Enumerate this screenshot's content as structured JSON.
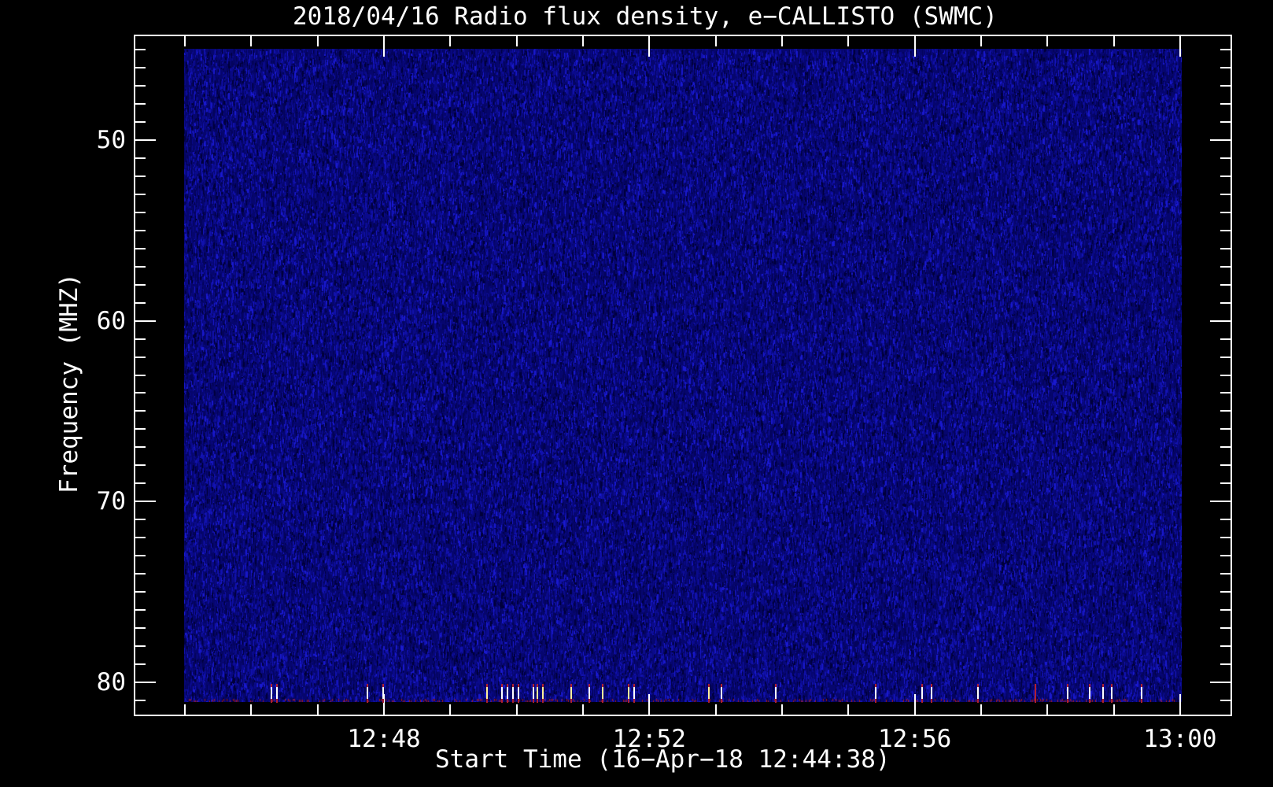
{
  "window": {
    "background": "#000000",
    "foreground": "#ffffff"
  },
  "chart_data": {
    "type": "heatmap",
    "title": "2018/04/16  Radio flux density, e−CALLISTO (SWMC)",
    "xlabel": "Start Time (16−Apr−18 12:44:38)",
    "ylabel": "Frequency (MHZ)",
    "legend": "none",
    "grid": false,
    "x_axis": {
      "start": "12:44:14",
      "end": "13:00:48",
      "major_ticks": [
        "12:48",
        "12:52",
        "12:56",
        "13:00"
      ],
      "minor_tick_interval_seconds": 60,
      "ticks_direction": "inward"
    },
    "y_axis": {
      "min_mhz": 44.2,
      "max_mhz": 81.9,
      "major_ticks": [
        50,
        60,
        70,
        80
      ],
      "minor_tick_interval_mhz": 1,
      "direction": "increasing-downward",
      "ticks_direction": "inward"
    },
    "image_extent": {
      "time_start": "12:45:00",
      "time_end": "13:00:01",
      "freq_start_mhz": 45.0,
      "freq_end_mhz": 81.1
    },
    "background_signal": {
      "description": "uniform dark-blue noise, no solar radio burst visible",
      "base_color": "#06066e",
      "palette": [
        "#00003a",
        "#04045c",
        "#0a0a8c",
        "#1111ad",
        "#1919cf"
      ],
      "bottom_edge_dot_color": "#a01818"
    },
    "rfi_marks": {
      "freq_mhz": 80.5,
      "colors": {
        "white": "#ffffff",
        "yellow": "#ffef9a",
        "red": "#b22030"
      },
      "events": [
        {
          "time": "12:46:18",
          "color": "white"
        },
        {
          "time": "12:46:23",
          "color": "white"
        },
        {
          "time": "12:47:45",
          "color": "white"
        },
        {
          "time": "12:47:59",
          "color": "white"
        },
        {
          "time": "12:49:33",
          "color": "yellow"
        },
        {
          "time": "12:49:47",
          "color": "white"
        },
        {
          "time": "12:49:52",
          "color": "white"
        },
        {
          "time": "12:49:57",
          "color": "white"
        },
        {
          "time": "12:50:02",
          "color": "white"
        },
        {
          "time": "12:50:15",
          "color": "white"
        },
        {
          "time": "12:50:19",
          "color": "yellow"
        },
        {
          "time": "12:50:24",
          "color": "yellow"
        },
        {
          "time": "12:50:49",
          "color": "yellow"
        },
        {
          "time": "12:51:06",
          "color": "white"
        },
        {
          "time": "12:51:18",
          "color": "yellow"
        },
        {
          "time": "12:51:41",
          "color": "yellow"
        },
        {
          "time": "12:51:46",
          "color": "white"
        },
        {
          "time": "12:52:54",
          "color": "yellow"
        },
        {
          "time": "12:53:05",
          "color": "white"
        },
        {
          "time": "12:53:54",
          "color": "white"
        },
        {
          "time": "12:55:25",
          "color": "white"
        },
        {
          "time": "12:56:07",
          "color": "white"
        },
        {
          "time": "12:56:15",
          "color": "white"
        },
        {
          "time": "12:56:57",
          "color": "white"
        },
        {
          "time": "12:57:49",
          "color": "red"
        },
        {
          "time": "12:58:18",
          "color": "white"
        },
        {
          "time": "12:58:38",
          "color": "white"
        },
        {
          "time": "12:58:50",
          "color": "white"
        },
        {
          "time": "12:58:58",
          "color": "white"
        },
        {
          "time": "12:59:25",
          "color": "white"
        }
      ]
    }
  }
}
